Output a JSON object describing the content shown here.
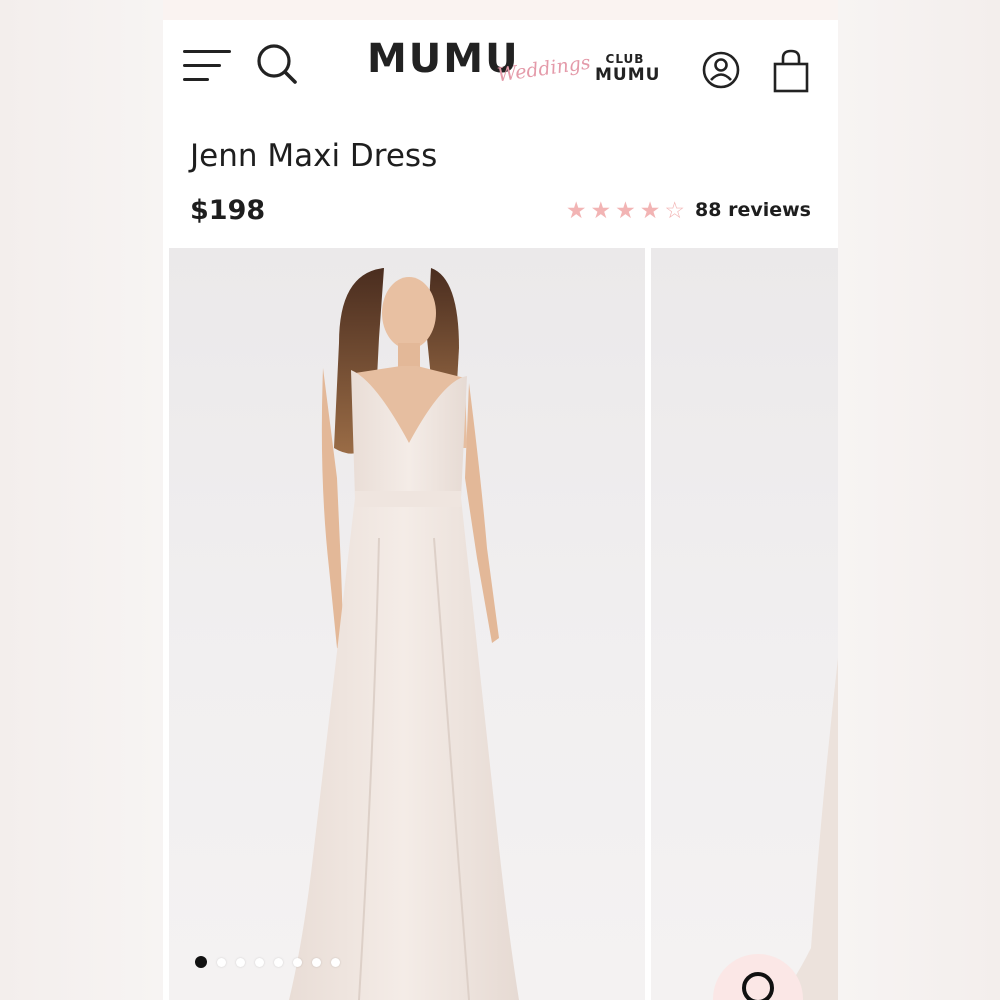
{
  "header": {
    "logo_main": "MUMU",
    "logo_script": "Weddings",
    "club_line1": "CLUB",
    "club_line2": "MUMU"
  },
  "product": {
    "title": "Jenn Maxi Dress",
    "price": "$198",
    "rating_value": 4,
    "rating_max": 5,
    "reviews_label": "88 reviews"
  },
  "gallery": {
    "slide_count": 8,
    "active_index": 0
  },
  "colors": {
    "star": "#f2b4b4",
    "brand_pink": "#e49aa9",
    "zoom_button_bg": "#fbe7e6",
    "text": "#1e1e1e"
  },
  "icons": [
    "menu-icon",
    "search-icon",
    "account-icon",
    "shopping-bag-icon",
    "star-icon",
    "zoom-icon"
  ]
}
